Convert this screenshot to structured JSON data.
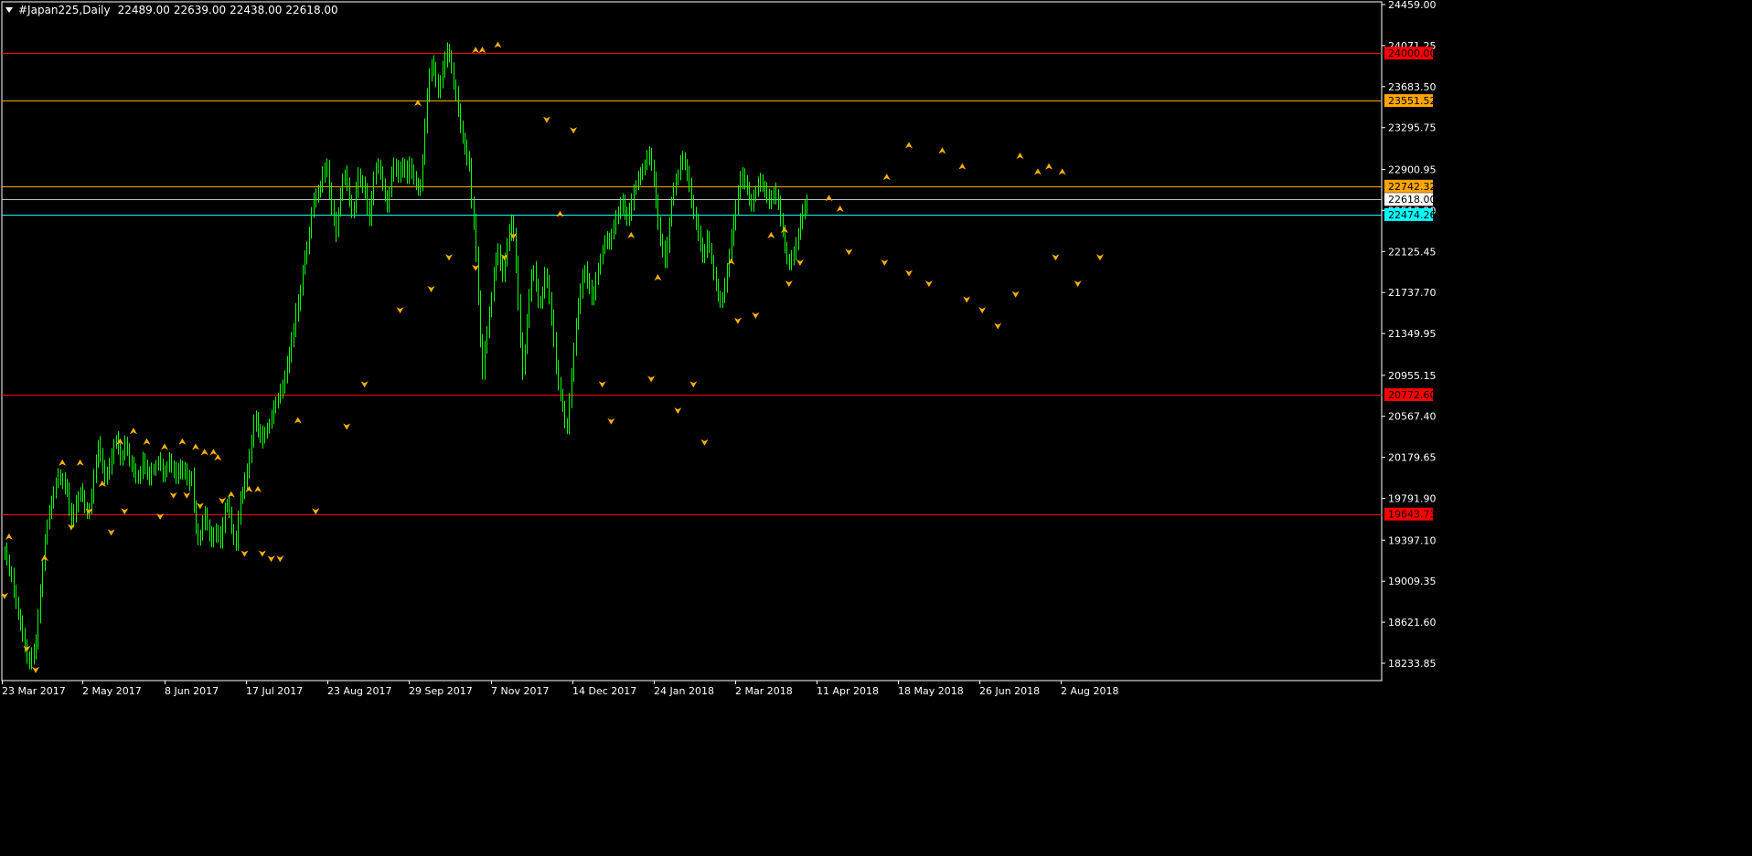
{
  "header": {
    "symbol": "#Japan225,Daily",
    "open": "22489.00",
    "high": "22639.00",
    "low": "22438.00",
    "close": "22618.00"
  },
  "colors": {
    "background": "#000000",
    "axis": "#ffffff",
    "candle": "#00ff00",
    "fractal": "#ffb000",
    "red_level": "#ff0000",
    "orange_level": "#ffa500",
    "cyan_level": "#00ffff",
    "price_line": "#c0c0c0"
  },
  "chart_data": {
    "type": "candlestick",
    "price_axis_labels": [
      "24459.00",
      "24071.25",
      "23683.50",
      "23295.75",
      "22900.95",
      "22513.20",
      "22125.45",
      "21737.70",
      "21349.95",
      "20955.15",
      "20567.40",
      "20179.65",
      "19791.90",
      "19397.10",
      "19009.35",
      "18621.60",
      "18233.85"
    ],
    "time_axis_labels": [
      "23 Mar 2017",
      "2 May 2017",
      "8 Jun 2017",
      "17 Jul 2017",
      "23 Aug 2017",
      "29 Sep 2017",
      "7 Nov 2017",
      "14 Dec 2017",
      "24 Jan 2018",
      "2 Mar 2018",
      "11 Apr 2018",
      "18 May 2018",
      "26 Jun 2018",
      "2 Aug 2018"
    ],
    "ylim": [
      18150,
      24459
    ],
    "levels": [
      {
        "price": 24000.0,
        "label": "24000.00",
        "kind": "red"
      },
      {
        "price": 23551.52,
        "label": "23551.52",
        "kind": "orange"
      },
      {
        "price": 22742.32,
        "label": "22742.32",
        "kind": "orange"
      },
      {
        "price": 22474.26,
        "label": "22474.26",
        "kind": "cyan"
      },
      {
        "price": 20772.6,
        "label": "20772.60",
        "kind": "red"
      },
      {
        "price": 19643.73,
        "label": "19643.73",
        "kind": "red"
      }
    ],
    "current_price": {
      "price": 22618.0,
      "label": "22618.00"
    },
    "closes": [
      19300,
      19200,
      19100,
      19050,
      18900,
      18800,
      18700,
      18600,
      18500,
      18400,
      18300,
      18250,
      18300,
      18350,
      18450,
      18700,
      18900,
      19150,
      19400,
      19550,
      19650,
      19750,
      19850,
      19950,
      20000,
      19980,
      19950,
      19900,
      19880,
      19700,
      19600,
      19650,
      19750,
      19800,
      19850,
      19800,
      19700,
      19650,
      19700,
      19800,
      20000,
      20150,
      20300,
      20200,
      20100,
      20000,
      20050,
      20100,
      20200,
      20300,
      20350,
      20250,
      20150,
      20200,
      20300,
      20250,
      20150,
      20100,
      20050,
      20000,
      20000,
      20050,
      20150,
      20100,
      20050,
      20000,
      20050,
      20050,
      20100,
      20150,
      20100,
      20000,
      20050,
      20100,
      20150,
      20100,
      20050,
      20000,
      20050,
      20100,
      20050,
      20050,
      20000,
      19950,
      20000,
      19700,
      19500,
      19400,
      19450,
      19550,
      19650,
      19550,
      19450,
      19400,
      19450,
      19500,
      19450,
      19400,
      19550,
      19700,
      19750,
      19650,
      19500,
      19400,
      19350,
      19600,
      19800,
      19850,
      19950,
      20050,
      20200,
      20350,
      20500,
      20550,
      20450,
      20400,
      20350,
      20400,
      20450,
      20500,
      20550,
      20650,
      20700,
      20750,
      20800,
      20850,
      20950,
      21050,
      21150,
      21300,
      21400,
      21550,
      21650,
      21750,
      21950,
      22050,
      22150,
      22300,
      22500,
      22600,
      22650,
      22700,
      22750,
      22850,
      22900,
      22950,
      22700,
      22550,
      22450,
      22300,
      22500,
      22650,
      22800,
      22850,
      22750,
      22600,
      22500,
      22550,
      22700,
      22850,
      22800,
      22750,
      22700,
      22550,
      22450,
      22650,
      22800,
      22900,
      22950,
      22850,
      22750,
      22650,
      22550,
      22700,
      22850,
      22950,
      22900,
      22850,
      22900,
      22950,
      22900,
      22850,
      22950,
      22900,
      22800,
      22750,
      22700,
      22750,
      23000,
      23300,
      23600,
      23800,
      23900,
      23850,
      23750,
      23650,
      23750,
      23850,
      23950,
      24050,
      23950,
      23850,
      23700,
      23600,
      23450,
      23300,
      23200,
      23100,
      23000,
      22950,
      22600,
      22400,
      22100,
      21700,
      21300,
      21000,
      21200,
      21350,
      21550,
      21700,
      21900,
      22050,
      22150,
      22000,
      21900,
      22050,
      22200,
      22300,
      22400,
      22300,
      22000,
      21650,
      21300,
      21000,
      21200,
      21450,
      21700,
      21900,
      21950,
      21800,
      21650,
      21650,
      21750,
      21900,
      21850,
      21700,
      21500,
      21300,
      21050,
      20900,
      20750,
      20650,
      20500,
      20450,
      20700,
      20950,
      21200,
      21450,
      21600,
      21750,
      21900,
      21950,
      21850,
      21800,
      21700,
      21750,
      21850,
      21950,
      22050,
      22150,
      22200,
      22250,
      22200,
      22300,
      22350,
      22450,
      22500,
      22550,
      22600,
      22500,
      22450,
      22500,
      22600,
      22700,
      22750,
      22800,
      22850,
      22900,
      22950,
      23000,
      23050,
      22950,
      22800,
      22600,
      22400,
      22250,
      22150,
      22050,
      22200,
      22400,
      22600,
      22700,
      22800,
      22850,
      22950,
      23000,
      22950,
      22850,
      22750,
      22600,
      22500,
      22400,
      22300,
      22200,
      22100,
      22150,
      22250,
      22150,
      22050,
      21900,
      21800,
      21700,
      21650,
      21700,
      21800,
      21950,
      22100,
      22250,
      22400,
      22550,
      22700,
      22800,
      22850,
      22800,
      22700,
      22600,
      22550,
      22650,
      22700,
      22750,
      22800,
      22750,
      22700,
      22650,
      22600,
      22650,
      22700,
      22650,
      22600,
      22450,
      22300,
      22150,
      22050,
      22000,
      22050,
      22100,
      22200,
      22300,
      22400,
      22500,
      22550,
      22618
    ]
  },
  "fractals": {
    "up": [
      [
        2,
        19400
      ],
      [
        18,
        19200
      ],
      [
        26,
        20100
      ],
      [
        34,
        20100
      ],
      [
        44,
        19900
      ],
      [
        52,
        20300
      ],
      [
        58,
        20400
      ],
      [
        64,
        20300
      ],
      [
        72,
        20250
      ],
      [
        80,
        20300
      ],
      [
        86,
        20250
      ],
      [
        90,
        20200
      ],
      [
        94,
        20200
      ],
      [
        96,
        20150
      ],
      [
        102,
        19800
      ],
      [
        110,
        19850
      ],
      [
        114,
        19850
      ],
      [
        132,
        20500
      ],
      [
        186,
        23500
      ],
      [
        212,
        24000
      ],
      [
        215,
        24000
      ],
      [
        222,
        24050
      ],
      [
        250,
        22450
      ],
      [
        282,
        22250
      ],
      [
        294,
        21850
      ],
      [
        327,
        22000
      ],
      [
        345,
        22250
      ],
      [
        351,
        22300
      ],
      [
        371,
        22600
      ],
      [
        376,
        22500
      ],
      [
        397,
        22800
      ],
      [
        407,
        23100
      ],
      [
        422,
        23050
      ],
      [
        431,
        22900
      ],
      [
        457,
        23000
      ],
      [
        465,
        22850
      ],
      [
        470,
        22900
      ],
      [
        476,
        22850
      ]
    ],
    "down": [
      [
        0,
        18900
      ],
      [
        10,
        18400
      ],
      [
        14,
        18200
      ],
      [
        30,
        19550
      ],
      [
        38,
        19700
      ],
      [
        48,
        19500
      ],
      [
        54,
        19700
      ],
      [
        70,
        19650
      ],
      [
        76,
        19850
      ],
      [
        82,
        19850
      ],
      [
        88,
        19750
      ],
      [
        98,
        19800
      ],
      [
        108,
        19300
      ],
      [
        116,
        19300
      ],
      [
        120,
        19250
      ],
      [
        124,
        19250
      ],
      [
        140,
        19700
      ],
      [
        154,
        20500
      ],
      [
        162,
        20900
      ],
      [
        178,
        21600
      ],
      [
        192,
        21800
      ],
      [
        200,
        22100
      ],
      [
        212,
        22000
      ],
      [
        225,
        22100
      ],
      [
        229,
        22300
      ],
      [
        244,
        23400
      ],
      [
        256,
        23300
      ],
      [
        269,
        20900
      ],
      [
        273,
        20550
      ],
      [
        291,
        20950
      ],
      [
        303,
        20650
      ],
      [
        310,
        20900
      ],
      [
        315,
        20350
      ],
      [
        330,
        21500
      ],
      [
        338,
        21550
      ],
      [
        353,
        21850
      ],
      [
        358,
        22050
      ],
      [
        380,
        22150
      ],
      [
        396,
        22050
      ],
      [
        407,
        21950
      ],
      [
        416,
        21850
      ],
      [
        433,
        21700
      ],
      [
        440,
        21600
      ],
      [
        447,
        21450
      ],
      [
        455,
        21750
      ],
      [
        473,
        22100
      ],
      [
        483,
        21850
      ],
      [
        493,
        22100
      ]
    ]
  }
}
